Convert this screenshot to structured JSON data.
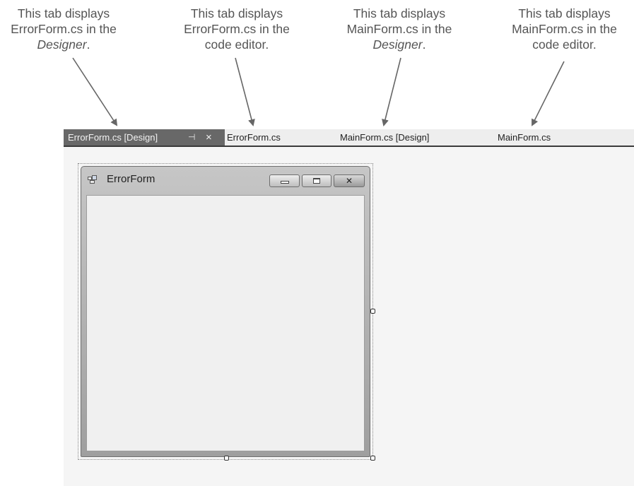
{
  "callouts": [
    {
      "line1": "This tab displays",
      "line2": "ErrorForm.cs in the",
      "line3_italic": "Designer",
      "line3_suffix": "."
    },
    {
      "line1": "This tab displays",
      "line2": "ErrorForm.cs in the",
      "line3": "code editor."
    },
    {
      "line1": "This tab displays",
      "line2": "MainForm.cs in the",
      "line3_italic": "Designer",
      "line3_suffix": "."
    },
    {
      "line1": "This tab displays",
      "line2": "MainForm.cs in the",
      "line3": "code editor."
    }
  ],
  "tabs": [
    {
      "label": "ErrorForm.cs [Design]",
      "active": true,
      "pin_icon": "⊣",
      "close_icon": "×"
    },
    {
      "label": "ErrorForm.cs",
      "active": false
    },
    {
      "label": "MainForm.cs [Design]",
      "active": false
    },
    {
      "label": "MainForm.cs",
      "active": false
    }
  ],
  "form": {
    "title": "ErrorForm",
    "icon": "form-icon",
    "close_glyph": "✕"
  }
}
